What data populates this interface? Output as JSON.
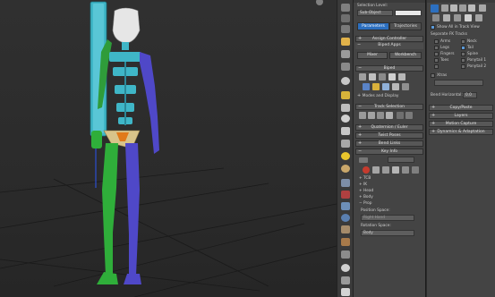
{
  "command_panel": {
    "selection_level_label": "Selection Level:",
    "selection_level_value": "Sub-Object",
    "tabs": [
      "Parameters",
      "Trajectories"
    ],
    "assign_controller": "Assign Controller",
    "biped_apps": "Biped Apps",
    "mixer": "Mixer",
    "workbench": "Workbench",
    "biped": "Biped",
    "modes_and_display": "Modes and Display",
    "track_selection": "Track Selection",
    "quaternion_euler": "Quaternion / Euler",
    "twist_poses": "Twist Poses",
    "bend_links": "Bend Links",
    "key_info": "Key Info",
    "tcb": "TCB",
    "ik": "IK",
    "head": "Head",
    "body": "Body",
    "prop": "Prop",
    "position_space_label": "Position Space:",
    "position_space_value": "Right Hand",
    "rotation_space_label": "Rotation Space:",
    "rotation_space_value": "Body"
  },
  "track_panel": {
    "show_all_label": "Show All in Track View",
    "separate_fk_tracks": "Separate FK Tracks",
    "tracks": [
      {
        "label": "Arms",
        "checked": false
      },
      {
        "label": "Neck",
        "checked": false
      },
      {
        "label": "Legs",
        "checked": false
      },
      {
        "label": "Tail",
        "checked": true
      },
      {
        "label": "Fingers",
        "checked": false
      },
      {
        "label": "Spine",
        "checked": false
      },
      {
        "label": "Toes",
        "checked": false
      },
      {
        "label": "Ponytail 1",
        "checked": false
      },
      {
        "label": "",
        "checked": false
      },
      {
        "label": "Ponytail 2",
        "checked": false
      }
    ],
    "xtras_label": "Xtras",
    "bend_horizontal_label": "Bend Horizontal:",
    "bend_horizontal_value": "0.0",
    "rollouts": [
      "Copy/Paste",
      "Layers",
      "Motion Capture",
      "Dynamics & Adaptation"
    ]
  },
  "colors": {
    "accent": "#2c6fbf",
    "biped_cyan": "#3fb6c7",
    "biped_green": "#2fae3a",
    "biped_blue": "#4f48c8",
    "biped_head": "#e6e6e6",
    "pelvis": "#d8c48a"
  }
}
